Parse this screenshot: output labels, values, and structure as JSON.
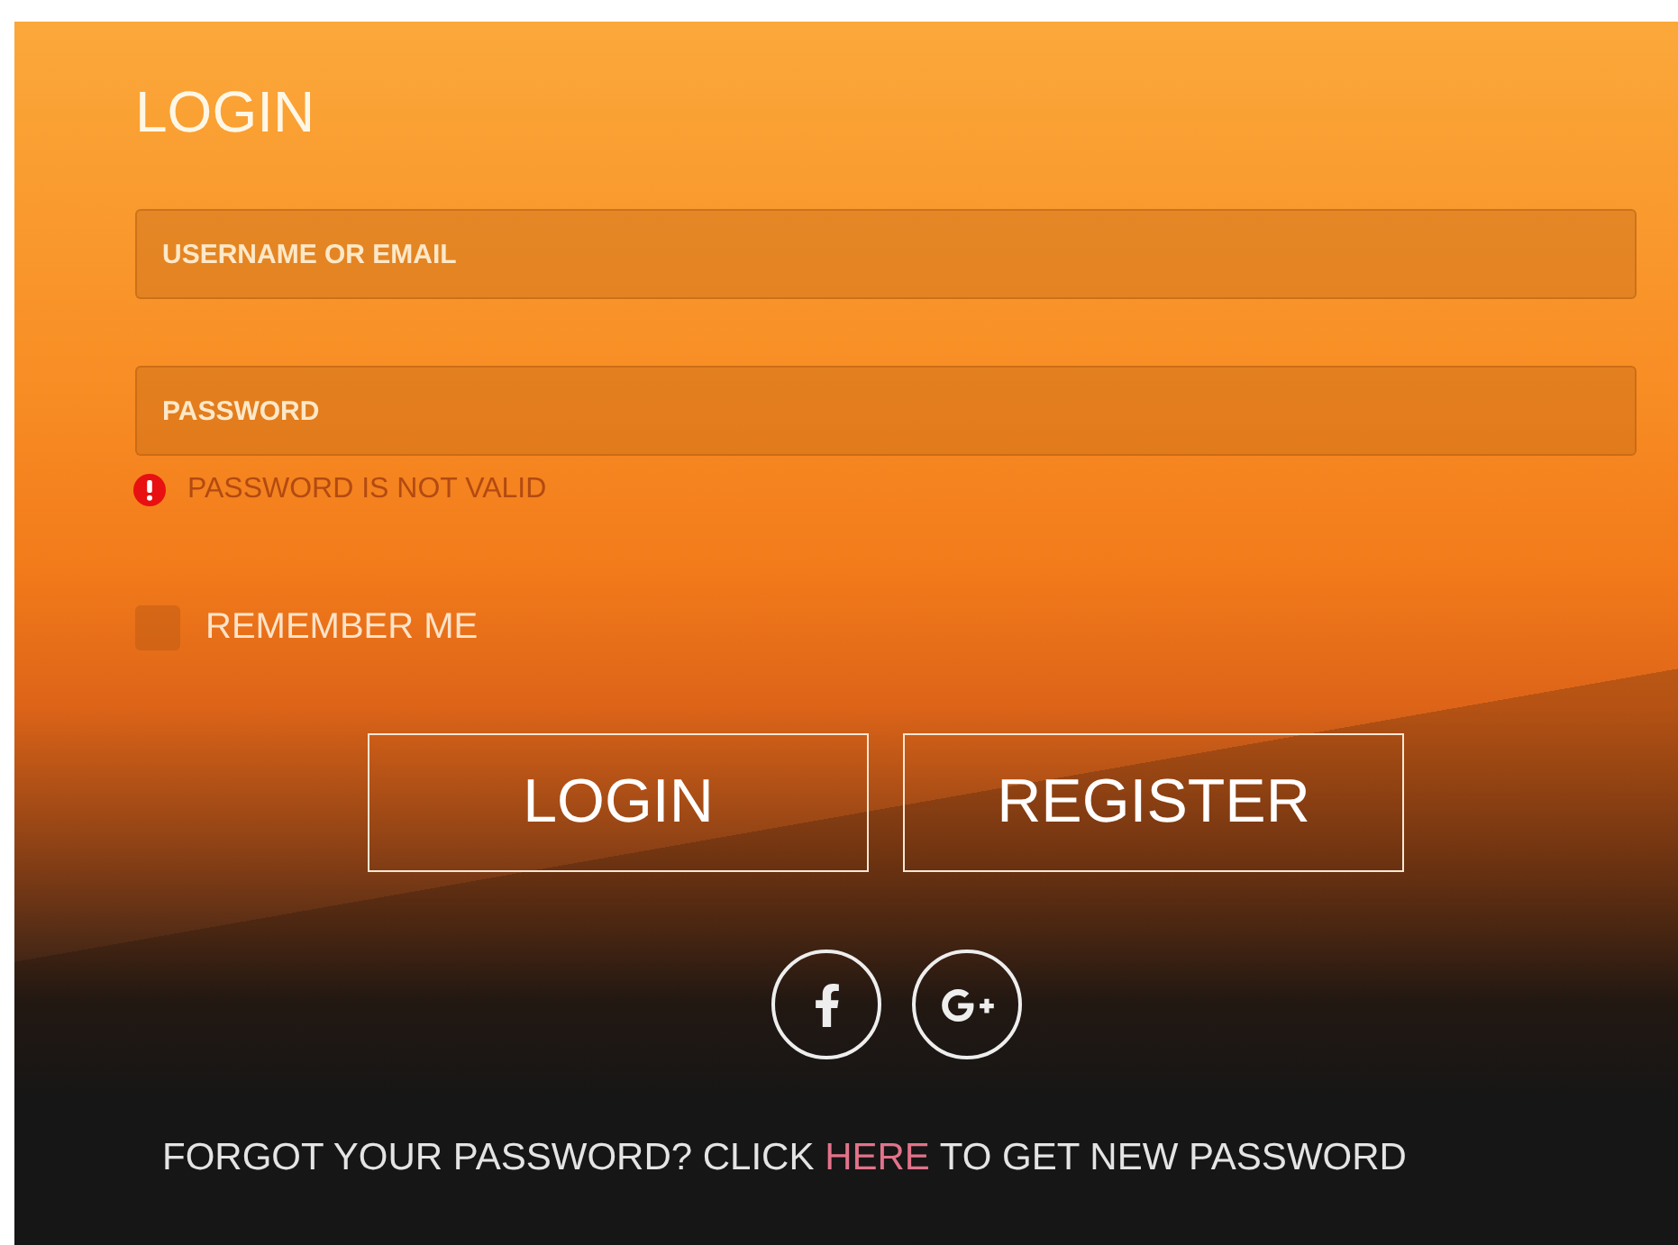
{
  "title": "LOGIN",
  "fields": [
    {
      "placeholder": "USERNAME OR EMAIL"
    },
    {
      "placeholder": "PASSWORD",
      "error": "PASSWORD IS NOT VALID"
    }
  ],
  "remember": {
    "label": "REMEMBER ME",
    "checked": false
  },
  "buttons": [
    "LOGIN",
    "REGISTER"
  ],
  "social": [
    {
      "kind": "facebook"
    },
    {
      "kind": "googleplus"
    }
  ],
  "forgot": {
    "before": "FORGOT YOUR PASSWORD? CLICK",
    "link": "HERE",
    "after": "TO GET NEW PASSWORD"
  }
}
